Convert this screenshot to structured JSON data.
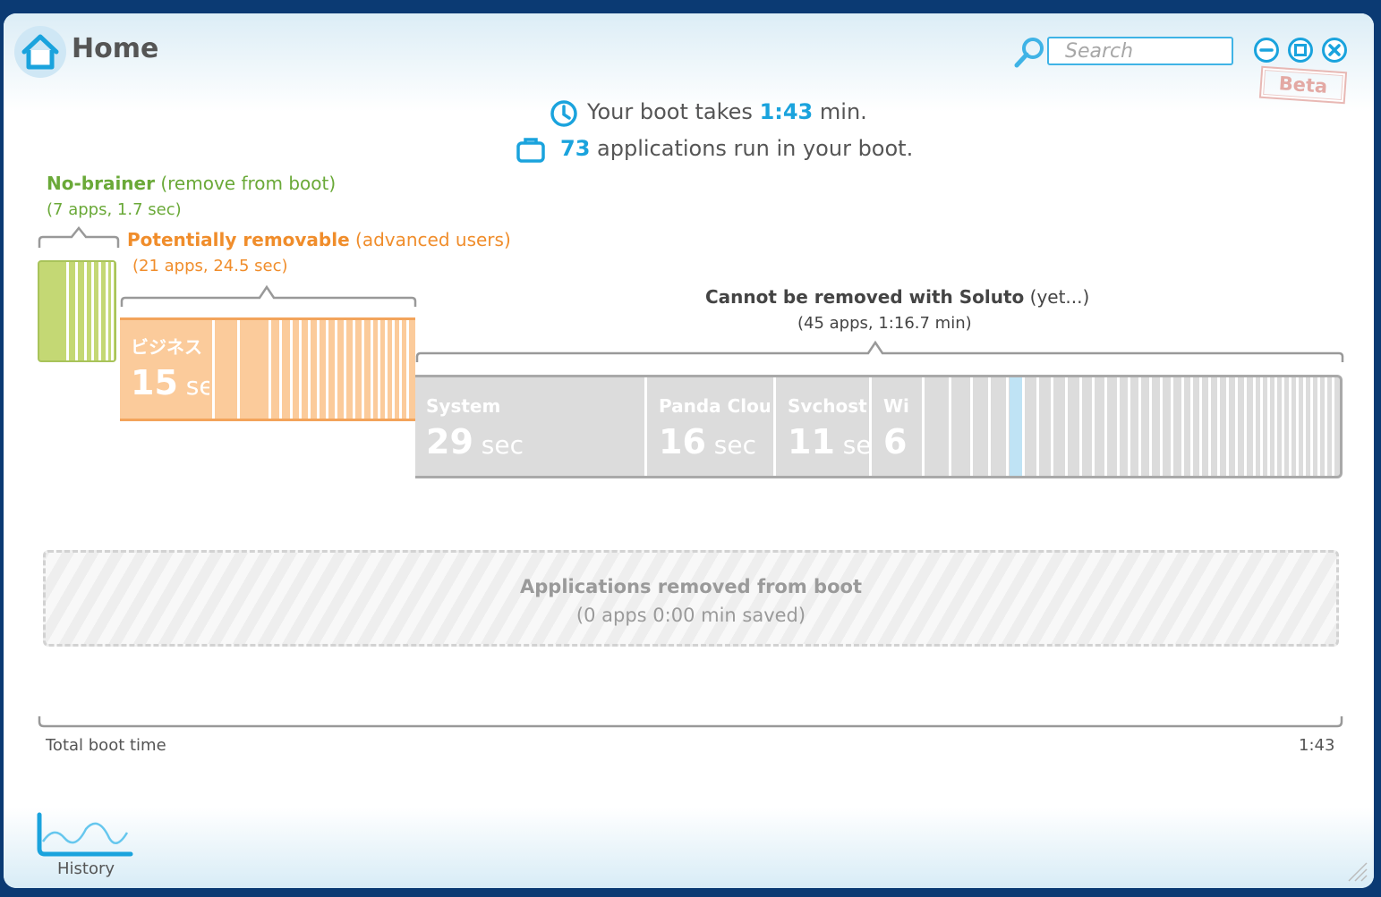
{
  "header": {
    "title": "Home",
    "search_placeholder": "Search",
    "beta_label": "Beta"
  },
  "summary": {
    "boot_prefix": "Your boot takes ",
    "boot_time": "1:43",
    "boot_suffix": " min.",
    "apps_count": "73",
    "apps_suffix": " applications run in your boot."
  },
  "categories": {
    "no_brainer": {
      "title": "No-brainer",
      "hint": " (remove from boot)",
      "sub": "(7 apps, 1.7 sec)"
    },
    "potentially": {
      "title": "Potentially removable",
      "hint": " (advanced users)",
      "sub": "(21 apps, 24.5 sec)"
    },
    "cannot": {
      "title": "Cannot be removed with Soluto",
      "hint": " (yet...)",
      "sub": "(45 apps, 1:16.7 min)"
    }
  },
  "apps": {
    "orange_first": {
      "name": "ビジネス",
      "value": "15",
      "unit": " sec"
    },
    "system": {
      "name": "System",
      "value": "29",
      "unit": " sec"
    },
    "panda": {
      "name": "Panda Cloud",
      "value": "16",
      "unit": " sec"
    },
    "svchost": {
      "name": "Svchost",
      "value": "11",
      "unit": " sec"
    },
    "wi": {
      "name": "Wi",
      "value": "6",
      "unit": ""
    }
  },
  "removed": {
    "title": "Applications removed from boot",
    "sub": "(0 apps 0:00 min saved)"
  },
  "timeline": {
    "start_label": "Total boot time",
    "end_label": "1:43"
  },
  "footer": {
    "history_label": "History"
  },
  "colors": {
    "accent": "#1aa3dd",
    "no_brainer": "#c4d874",
    "potentially": "#fbcb9b",
    "cannot": "#dcdcdc",
    "highlight_segment": "#bfe3f5"
  }
}
